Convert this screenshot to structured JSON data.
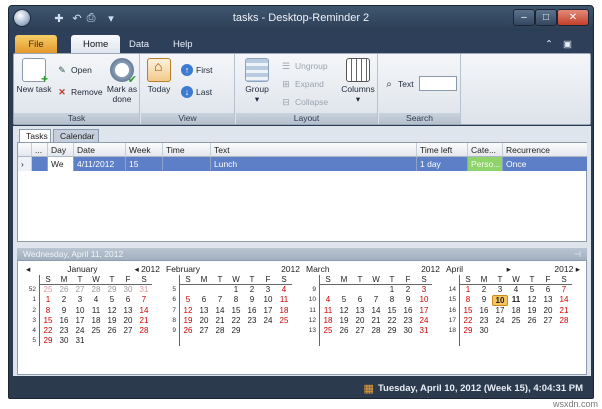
{
  "window": {
    "title": "tasks - Desktop-Reminder 2"
  },
  "menu": {
    "tabs": [
      "File",
      "Home",
      "Data",
      "Help"
    ]
  },
  "ribbon": {
    "task": {
      "label": "Task",
      "new_task": "New task",
      "open": "Open",
      "remove": "Remove",
      "mark_done": "Mark as done"
    },
    "view": {
      "label": "View",
      "today": "Today",
      "first": "First",
      "last": "Last"
    },
    "layout": {
      "label": "Layout",
      "group": "Group",
      "ungroup": "Ungroup",
      "expand": "Expand",
      "collapse": "Collapse",
      "columns": "Columns"
    },
    "search": {
      "label": "Search",
      "text_label": "Text",
      "text_value": ""
    }
  },
  "doc_tabs": [
    "Tasks",
    "Calendar"
  ],
  "grid": {
    "columns": [
      "...",
      "Day",
      "Date",
      "Week",
      "Time",
      "Text",
      "Time left",
      "Cate...",
      "Recurrence"
    ],
    "rows": [
      {
        "day": "We",
        "date": "4/11/2012",
        "week": "15",
        "time": "",
        "text": "Lunch",
        "time_left": "1 day",
        "category": "Perso...",
        "recurrence": "Once"
      }
    ]
  },
  "calendar_header": "Wednesday, April 11, 2012",
  "dow": [
    "S",
    "M",
    "T",
    "W",
    "T",
    "F",
    "S"
  ],
  "months": [
    {
      "name": "January",
      "year": "2012",
      "weeks": [
        {
          "w": "52",
          "d": [
            "25",
            "26",
            "27",
            "28",
            "29",
            "30",
            "31"
          ],
          "cls": [
            "gr",
            "g",
            "g",
            "g",
            "g",
            "g",
            "gr"
          ]
        },
        {
          "w": "1",
          "d": [
            "1",
            "2",
            "3",
            "4",
            "5",
            "6",
            "7"
          ],
          "cls": [
            "r",
            "",
            "",
            "",
            "",
            "",
            "r"
          ]
        },
        {
          "w": "2",
          "d": [
            "8",
            "9",
            "10",
            "11",
            "12",
            "13",
            "14"
          ],
          "cls": [
            "r",
            "",
            "",
            "",
            "",
            "",
            "r"
          ]
        },
        {
          "w": "3",
          "d": [
            "15",
            "16",
            "17",
            "18",
            "19",
            "20",
            "21"
          ],
          "cls": [
            "r",
            "",
            "",
            "",
            "",
            "",
            "r"
          ]
        },
        {
          "w": "4",
          "d": [
            "22",
            "23",
            "24",
            "25",
            "26",
            "27",
            "28"
          ],
          "cls": [
            "r",
            "",
            "",
            "",
            "",
            "",
            "r"
          ]
        },
        {
          "w": "5",
          "d": [
            "29",
            "30",
            "31",
            "",
            "",
            "",
            ""
          ],
          "cls": [
            "r",
            "",
            "",
            "",
            "",
            "",
            ""
          ]
        }
      ]
    },
    {
      "name": "February",
      "year": "2012",
      "weeks": [
        {
          "w": "5",
          "d": [
            "",
            "",
            "",
            "1",
            "2",
            "3",
            "4"
          ],
          "cls": [
            "",
            "",
            "",
            "",
            "",
            "",
            "r"
          ]
        },
        {
          "w": "6",
          "d": [
            "5",
            "6",
            "7",
            "8",
            "9",
            "10",
            "11"
          ],
          "cls": [
            "r",
            "",
            "",
            "",
            "",
            "",
            "r"
          ]
        },
        {
          "w": "7",
          "d": [
            "12",
            "13",
            "14",
            "15",
            "16",
            "17",
            "18"
          ],
          "cls": [
            "r",
            "",
            "",
            "",
            "",
            "",
            "r"
          ]
        },
        {
          "w": "8",
          "d": [
            "19",
            "20",
            "21",
            "22",
            "23",
            "24",
            "25"
          ],
          "cls": [
            "r",
            "",
            "",
            "",
            "",
            "",
            "r"
          ]
        },
        {
          "w": "9",
          "d": [
            "26",
            "27",
            "28",
            "29",
            "",
            "",
            ""
          ],
          "cls": [
            "r",
            "",
            "",
            "",
            "",
            "",
            ""
          ]
        },
        {
          "w": "",
          "d": [
            "",
            "",
            "",
            "",
            "",
            "",
            ""
          ],
          "cls": [
            "",
            "",
            "",
            "",
            "",
            "",
            ""
          ]
        }
      ]
    },
    {
      "name": "March",
      "year": "2012",
      "weeks": [
        {
          "w": "9",
          "d": [
            "",
            "",
            "",
            "",
            "1",
            "2",
            "3"
          ],
          "cls": [
            "",
            "",
            "",
            "",
            "",
            "",
            "r"
          ]
        },
        {
          "w": "10",
          "d": [
            "4",
            "5",
            "6",
            "7",
            "8",
            "9",
            "10"
          ],
          "cls": [
            "r",
            "",
            "",
            "",
            "",
            "",
            "r"
          ]
        },
        {
          "w": "11",
          "d": [
            "11",
            "12",
            "13",
            "14",
            "15",
            "16",
            "17"
          ],
          "cls": [
            "r",
            "",
            "",
            "",
            "",
            "",
            "r"
          ]
        },
        {
          "w": "12",
          "d": [
            "18",
            "19",
            "20",
            "21",
            "22",
            "23",
            "24"
          ],
          "cls": [
            "r",
            "",
            "",
            "",
            "",
            "",
            "r"
          ]
        },
        {
          "w": "13",
          "d": [
            "25",
            "26",
            "27",
            "28",
            "29",
            "30",
            "31"
          ],
          "cls": [
            "r",
            "",
            "",
            "",
            "",
            "",
            "r"
          ]
        },
        {
          "w": "",
          "d": [
            "",
            "",
            "",
            "",
            "",
            "",
            ""
          ],
          "cls": [
            "",
            "",
            "",
            "",
            "",
            "",
            ""
          ]
        }
      ]
    },
    {
      "name": "April",
      "year": "2012",
      "weeks": [
        {
          "w": "14",
          "d": [
            "1",
            "2",
            "3",
            "4",
            "5",
            "6",
            "7"
          ],
          "cls": [
            "r",
            "",
            "",
            "",
            "",
            "",
            "r"
          ]
        },
        {
          "w": "15",
          "d": [
            "8",
            "9",
            "10",
            "11",
            "12",
            "13",
            "14"
          ],
          "cls": [
            "r",
            "",
            "t",
            "b",
            "",
            "",
            "r"
          ]
        },
        {
          "w": "16",
          "d": [
            "15",
            "16",
            "17",
            "18",
            "19",
            "20",
            "21"
          ],
          "cls": [
            "r",
            "",
            "",
            "",
            "",
            "",
            "r"
          ]
        },
        {
          "w": "17",
          "d": [
            "22",
            "23",
            "24",
            "25",
            "26",
            "27",
            "28"
          ],
          "cls": [
            "r",
            "",
            "",
            "",
            "",
            "",
            "r"
          ]
        },
        {
          "w": "18",
          "d": [
            "29",
            "30",
            "",
            "",
            "",
            "",
            ""
          ],
          "cls": [
            "r",
            "",
            "",
            "",
            "",
            "",
            ""
          ]
        },
        {
          "w": "",
          "d": [
            "",
            "",
            "",
            "",
            "",
            "",
            ""
          ],
          "cls": [
            "",
            "",
            "",
            "",
            "",
            "",
            ""
          ]
        }
      ]
    }
  ],
  "status": {
    "text": "Tuesday, April 10, 2012 (Week 15), 4:04:31 PM"
  },
  "watermark": "wsxdn.com"
}
